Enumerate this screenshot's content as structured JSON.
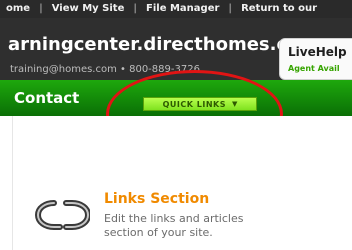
{
  "topbar": {
    "links": [
      "ome",
      "View My Site",
      "File Manager",
      "Return to our"
    ]
  },
  "header": {
    "site_name": "arningcenter.directhomes.com",
    "contact_line": "training@homes.com • 800-889-3726",
    "livehelp": {
      "title": "LiveHelp",
      "status": "Agent Avail"
    }
  },
  "nav": {
    "contact_label": "Contact",
    "quicklinks_label": "QUICK LINKS",
    "quicklinks_chevron": "▼"
  },
  "section": {
    "title": "Links Section",
    "description": "Edit the links and articles section of your site."
  },
  "colors": {
    "nav_green": "#1ea80c",
    "quicklinks_bg": "#8fe82a",
    "highlight": "#e11414",
    "title_orange": "#f08a00"
  }
}
